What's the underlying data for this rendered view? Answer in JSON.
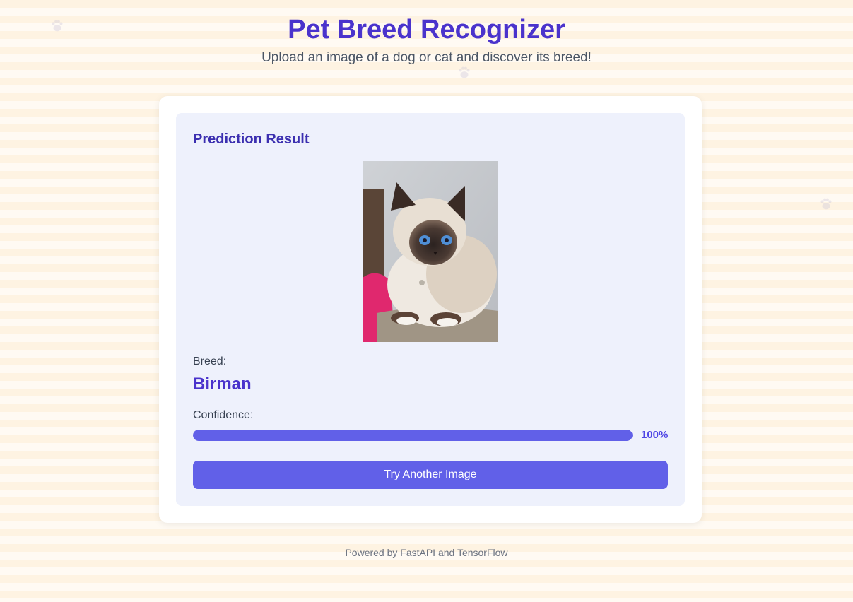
{
  "header": {
    "title": "Pet Breed Recognizer",
    "subtitle": "Upload an image of a dog or cat and discover its breed!"
  },
  "result": {
    "heading": "Prediction Result",
    "image_alt": "Uploaded pet photo",
    "breed_label": "Breed:",
    "breed_value": "Birman",
    "confidence_label": "Confidence:",
    "confidence_value": "100%",
    "confidence_fraction": 1.0,
    "try_again_label": "Try Another Image"
  },
  "footer": {
    "text": "Powered by FastAPI and TensorFlow"
  },
  "colors": {
    "accent": "#4a33cc",
    "button": "#6160e8",
    "panel": "#eef1fc"
  },
  "decorations": {
    "icon": "paw-print-icon"
  }
}
